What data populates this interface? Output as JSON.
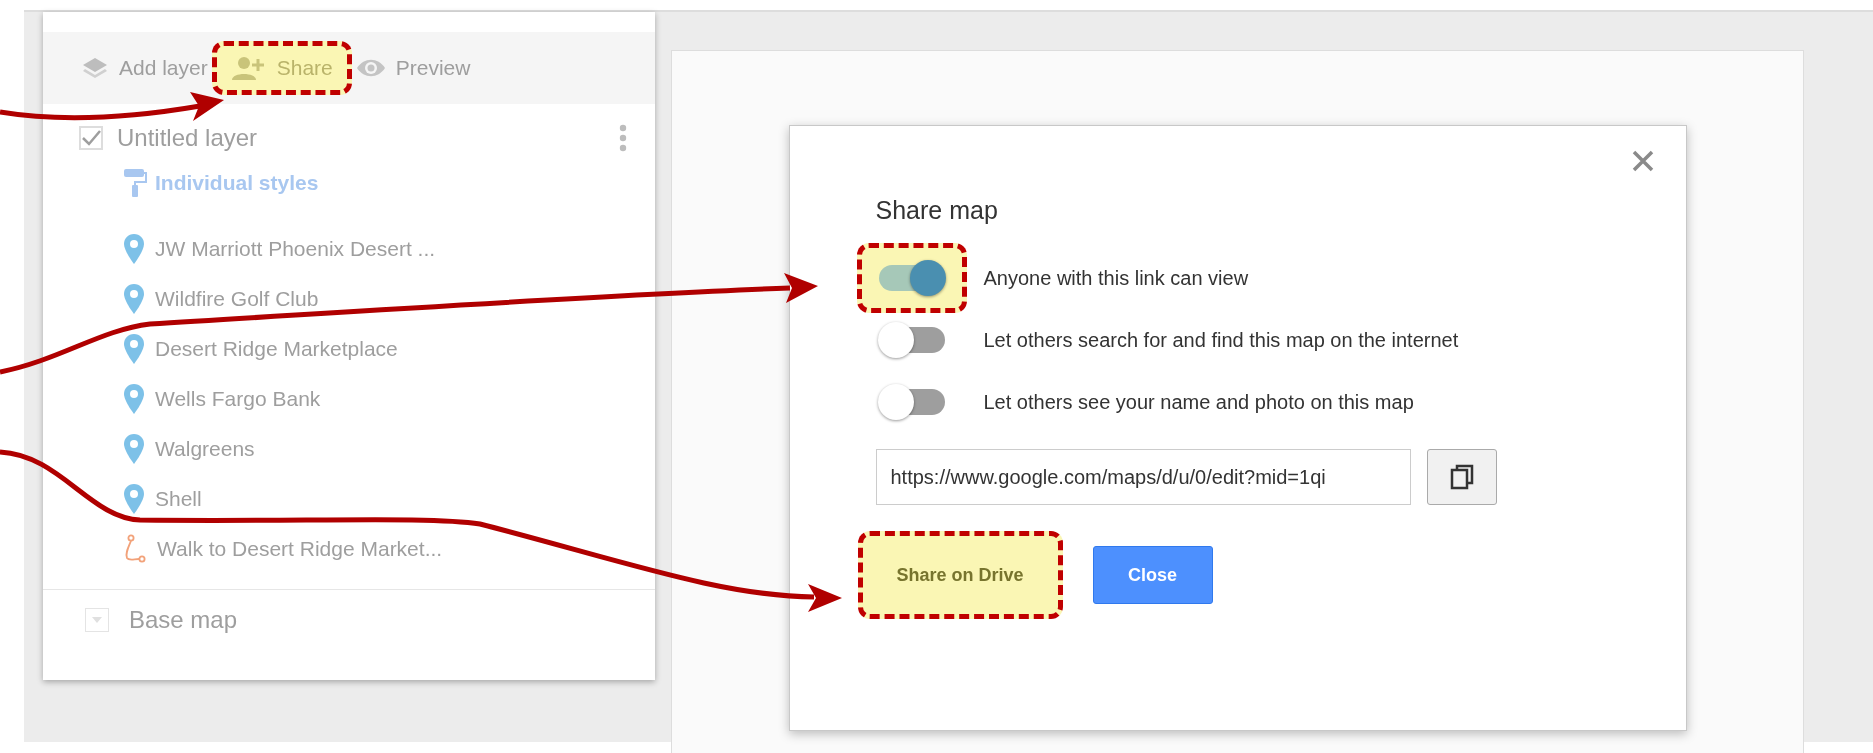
{
  "toolbar": [
    {
      "kind": "add_layer",
      "label": "Add layer",
      "highlighted": false
    },
    {
      "kind": "share",
      "label": "Share",
      "highlighted": true
    },
    {
      "kind": "preview",
      "label": "Preview",
      "highlighted": false
    }
  ],
  "layer": {
    "title": "Untitled layer",
    "checked": true,
    "style_label": "Individual styles",
    "items": [
      {
        "kind": "marker",
        "label": "JW Marriott Phoenix Desert ..."
      },
      {
        "kind": "marker",
        "label": "Wildfire Golf Club"
      },
      {
        "kind": "marker",
        "label": "Desert Ridge Marketplace"
      },
      {
        "kind": "marker",
        "label": "Wells Fargo Bank"
      },
      {
        "kind": "marker",
        "label": "Walgreens"
      },
      {
        "kind": "marker",
        "label": "Shell"
      },
      {
        "kind": "route",
        "label": "Walk to Desert Ridge Market..."
      }
    ]
  },
  "base_map": {
    "label": "Base map"
  },
  "dialog": {
    "title": "Share map",
    "toggles": [
      {
        "label": "Anyone with this link can view",
        "on": true,
        "highlighted": true
      },
      {
        "label": "Let others search for and find this map on the internet",
        "on": false,
        "highlighted": false
      },
      {
        "label": "Let others see your name and photo on this map",
        "on": false,
        "highlighted": false
      }
    ],
    "link": {
      "value": "https://www.google.com/maps/d/u/0/edit?mid=1qi"
    },
    "buttons": [
      {
        "kind": "secondary",
        "label": "Share on Drive",
        "highlighted": true
      },
      {
        "kind": "primary",
        "label": "Close",
        "highlighted": false
      }
    ]
  }
}
